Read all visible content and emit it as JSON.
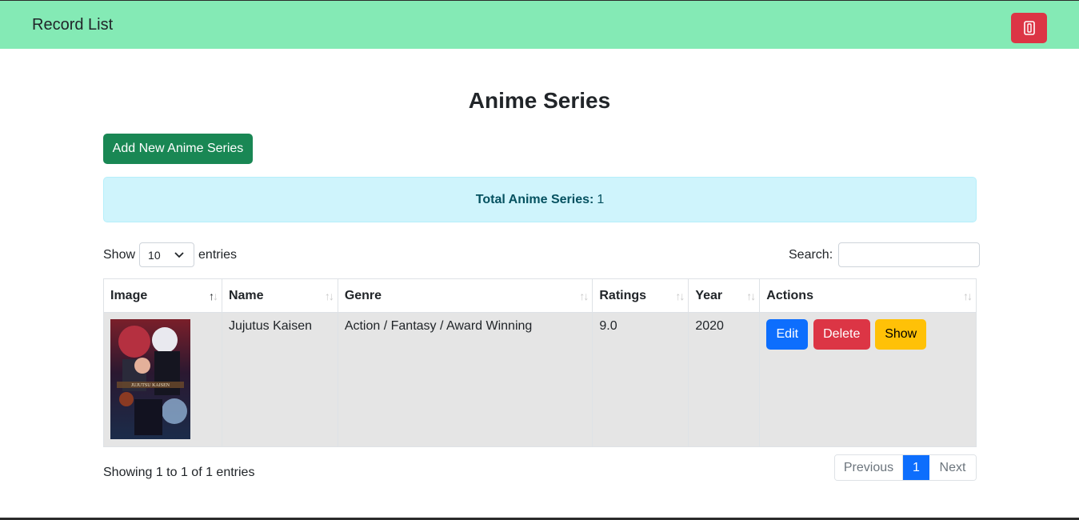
{
  "navbar": {
    "brand": "Record List",
    "logout_icon": "door-exit-icon"
  },
  "page": {
    "title": "Anime Series",
    "add_button": "Add New Anime Series"
  },
  "alert": {
    "label": "Total Anime Series:",
    "count": "1"
  },
  "controls": {
    "show": "Show",
    "entries_value": "10",
    "entries": "entries",
    "search": "Search:"
  },
  "table": {
    "headers": [
      "Image",
      "Name",
      "Genre",
      "Ratings",
      "Year",
      "Actions"
    ],
    "rows": [
      {
        "name": "Jujutus Kaisen",
        "genre": "Action / Fantasy / Award Winning",
        "ratings": "9.0",
        "year": "2020",
        "poster_text": "JUJUTSU KAISEN"
      }
    ],
    "actions": {
      "edit": "Edit",
      "delete": "Delete",
      "show": "Show"
    }
  },
  "footer": {
    "info": "Showing 1 to 1 of 1 entries",
    "previous": "Previous",
    "page": "1",
    "next": "Next"
  },
  "colors": {
    "navbar": "#84eab5",
    "danger": "#dc3545",
    "success": "#198754",
    "primary": "#0d6efd",
    "warning": "#ffc107",
    "info_bg": "#cff4fc"
  }
}
